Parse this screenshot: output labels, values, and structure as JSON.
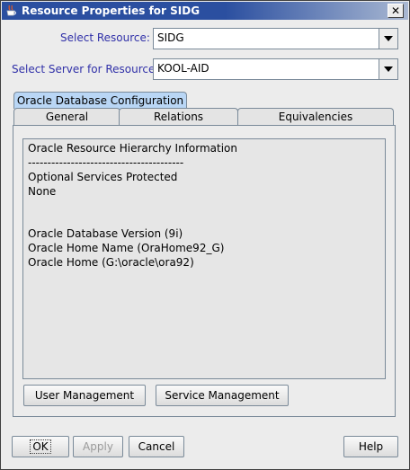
{
  "window": {
    "title": "Resource Properties for SIDG",
    "close_glyph": "✕"
  },
  "select_resource": {
    "label": "Select Resource:",
    "value": "SIDG"
  },
  "select_server": {
    "label": "Select Server for Resource:",
    "value": "KOOL-AID"
  },
  "tabs": {
    "oracle_config": "Oracle Database Configuration",
    "general": "General",
    "relations": "Relations",
    "equivalencies": "Equivalencies"
  },
  "info": {
    "lines": [
      "Oracle Resource Hierarchy Information",
      "----------------------------------------",
      "Optional Services Protected",
      "None",
      "",
      "",
      "Oracle Database Version (9i)",
      "Oracle Home Name (OraHome92_G)",
      "Oracle Home (G:\\oracle\\ora92)"
    ]
  },
  "panel_buttons": {
    "user_management": "User Management",
    "service_management": "Service Management"
  },
  "dialog_buttons": {
    "ok": "OK",
    "apply": "Apply",
    "cancel": "Cancel",
    "help": "Help"
  },
  "colors": {
    "title_bar": "#2b4fa0",
    "label_text": "#3030a8",
    "selected_tab": "#b9d6f5"
  },
  "icons": {
    "window_icon": "java-coffee-cup-icon",
    "dropdown": "chevron-down-icon",
    "close": "close-icon"
  }
}
